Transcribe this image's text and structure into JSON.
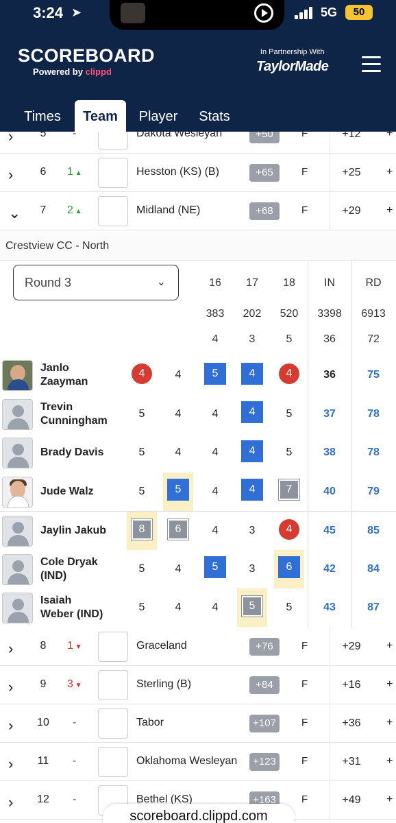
{
  "status_bar": {
    "time": "3:24",
    "network": "5G",
    "battery": "50"
  },
  "header": {
    "logo": "SCOREBOARD",
    "powered_by": "Powered by",
    "powered_brand": "clippd",
    "partner_text": "In Partnership With",
    "partner_brand": "TaylorMade"
  },
  "tabs": [
    "Times",
    "Team",
    "Player",
    "Stats"
  ],
  "teams_above": [
    {
      "rank": "5",
      "move": "-",
      "dir": "none",
      "name": "Dakota Wesleyan",
      "total": "+50",
      "thru": "F",
      "topar": "+12",
      "today": "+"
    },
    {
      "rank": "6",
      "move": "1",
      "dir": "up",
      "name": "Hesston (KS) (B)",
      "total": "+65",
      "thru": "F",
      "topar": "+25",
      "today": "+"
    },
    {
      "rank": "7",
      "move": "2",
      "dir": "up",
      "name": "Midland (NE)",
      "total": "+68",
      "thru": "F",
      "topar": "+29",
      "today": "+"
    }
  ],
  "course_name": "Crestview CC - North",
  "scorecard": {
    "round_label": "Round 3",
    "holes": [
      "16",
      "17",
      "18"
    ],
    "in_label": "IN",
    "rd_label": "RD",
    "yardage": [
      "383",
      "202",
      "520"
    ],
    "yardage_in": "3398",
    "yardage_rd": "6913",
    "par": [
      "4",
      "3",
      "5"
    ],
    "par_in": "36",
    "par_rd": "72",
    "players": [
      {
        "name_l1": "Janlo",
        "name_l2": "Zaayman",
        "scores": [
          "4",
          "4",
          "5",
          "4",
          "4"
        ],
        "in": "36",
        "rd": "75"
      },
      {
        "name_l1": "Trevin",
        "name_l2": "Cunningham",
        "scores": [
          "5",
          "4",
          "4",
          "4",
          "5"
        ],
        "in": "37",
        "rd": "78"
      },
      {
        "name_l1": "Brady Davis",
        "name_l2": "",
        "scores": [
          "5",
          "4",
          "4",
          "4",
          "5"
        ],
        "in": "38",
        "rd": "78"
      },
      {
        "name_l1": "Jude Walz",
        "name_l2": "",
        "scores": [
          "5",
          "5",
          "4",
          "4",
          "7"
        ],
        "in": "40",
        "rd": "79"
      },
      {
        "name_l1": "Jaylin Jakub",
        "name_l2": "",
        "scores": [
          "8",
          "6",
          "4",
          "3",
          "4"
        ],
        "in": "45",
        "rd": "85"
      },
      {
        "name_l1": "Cole Dryak",
        "name_l2": "(IND)",
        "scores": [
          "5",
          "4",
          "5",
          "3",
          "6"
        ],
        "in": "42",
        "rd": "84"
      },
      {
        "name_l1": "Isaiah",
        "name_l2": "Weber (IND)",
        "scores": [
          "5",
          "4",
          "4",
          "5",
          "5"
        ],
        "in": "43",
        "rd": "87"
      }
    ]
  },
  "teams_below": [
    {
      "rank": "8",
      "move": "1",
      "dir": "down",
      "name": "Graceland",
      "total": "+76",
      "thru": "F",
      "topar": "+29",
      "today": "+"
    },
    {
      "rank": "9",
      "move": "3",
      "dir": "down",
      "name": "Sterling (B)",
      "total": "+84",
      "thru": "F",
      "topar": "+16",
      "today": "+"
    },
    {
      "rank": "10",
      "move": "-",
      "dir": "none",
      "name": "Tabor",
      "total": "+107",
      "thru": "F",
      "topar": "+36",
      "today": "+"
    },
    {
      "rank": "11",
      "move": "-",
      "dir": "none",
      "name": "Oklahoma Wesleyan",
      "total": "+123",
      "thru": "F",
      "topar": "+31",
      "today": "+"
    },
    {
      "rank": "12",
      "move": "-",
      "dir": "none",
      "name": "Bethel (KS)",
      "total": "+163",
      "thru": "F",
      "topar": "+49",
      "today": "+"
    }
  ],
  "url": "scoreboard.clippd.com",
  "colors": {
    "navy": "#0f2547",
    "birdie": "#d63a30",
    "bogey": "#2f6fd6",
    "double": "#8c939d",
    "highlight": "#fbefc6",
    "up": "#2a9d3c",
    "down": "#c0392b"
  }
}
